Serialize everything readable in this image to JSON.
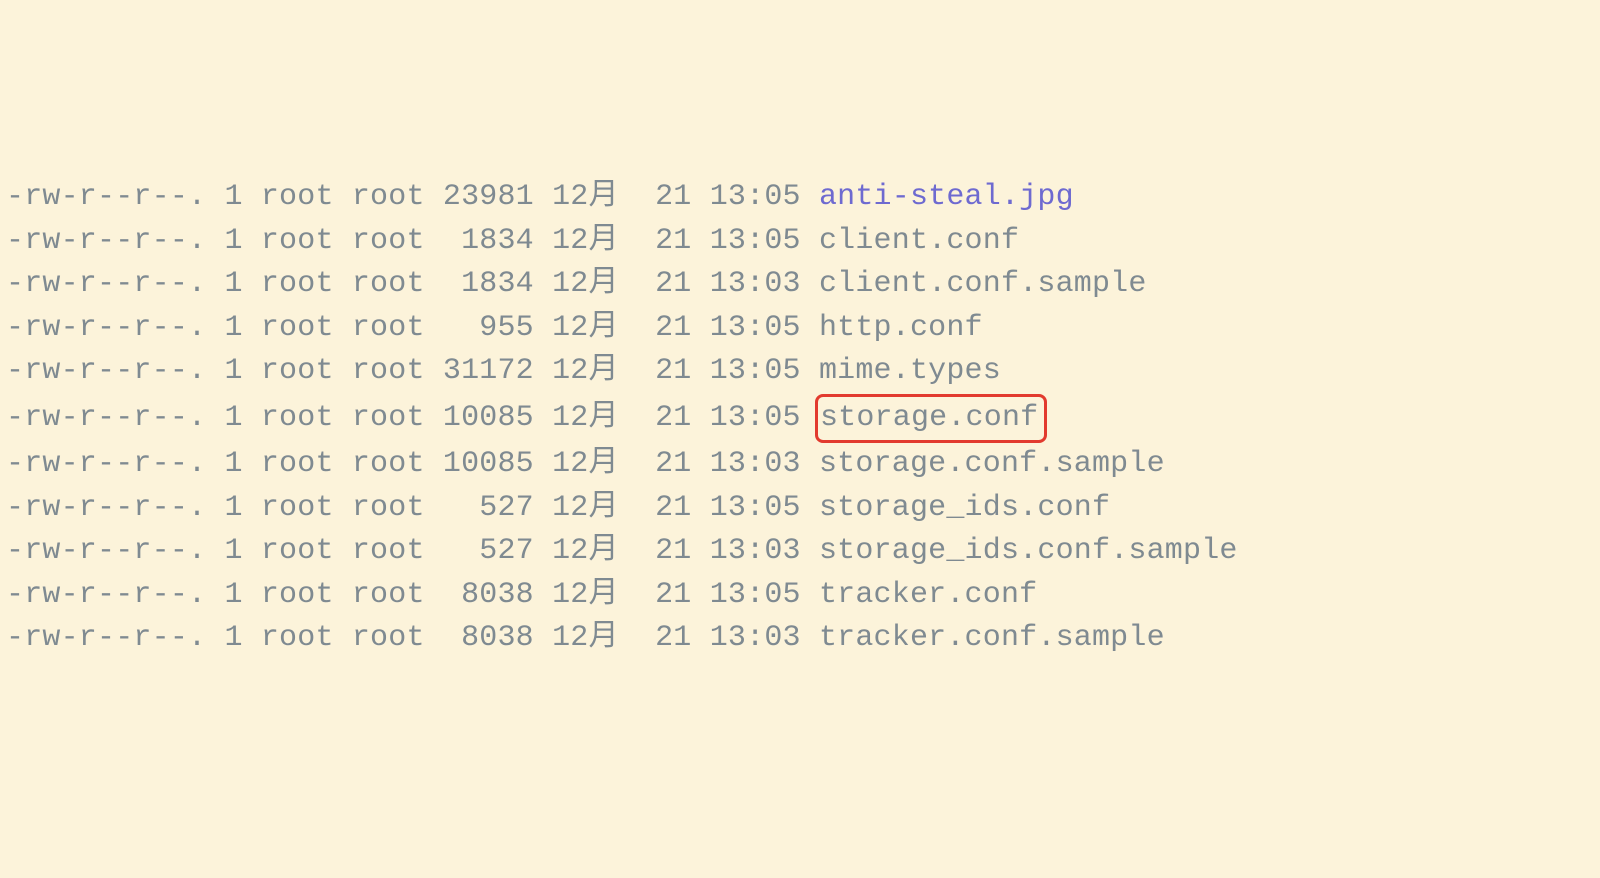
{
  "listing": [
    {
      "perms": "-rw-r--r--.",
      "links": "1",
      "owner": "root",
      "group": "root",
      "size": "23981",
      "month": "12月",
      "day": "21",
      "time": "13:05",
      "name": "anti-steal.jpg",
      "kind": "img",
      "highlighted": false
    },
    {
      "perms": "-rw-r--r--.",
      "links": "1",
      "owner": "root",
      "group": "root",
      "size": " 1834",
      "month": "12月",
      "day": "21",
      "time": "13:05",
      "name": "client.conf",
      "kind": "plain",
      "highlighted": false
    },
    {
      "perms": "-rw-r--r--.",
      "links": "1",
      "owner": "root",
      "group": "root",
      "size": " 1834",
      "month": "12月",
      "day": "21",
      "time": "13:03",
      "name": "client.conf.sample",
      "kind": "plain",
      "highlighted": false
    },
    {
      "perms": "-rw-r--r--.",
      "links": "1",
      "owner": "root",
      "group": "root",
      "size": "  955",
      "month": "12月",
      "day": "21",
      "time": "13:05",
      "name": "http.conf",
      "kind": "plain",
      "highlighted": false
    },
    {
      "perms": "-rw-r--r--.",
      "links": "1",
      "owner": "root",
      "group": "root",
      "size": "31172",
      "month": "12月",
      "day": "21",
      "time": "13:05",
      "name": "mime.types",
      "kind": "plain",
      "highlighted": false
    },
    {
      "perms": "-rw-r--r--.",
      "links": "1",
      "owner": "root",
      "group": "root",
      "size": "10085",
      "month": "12月",
      "day": "21",
      "time": "13:05",
      "name": "storage.conf",
      "kind": "plain",
      "highlighted": true
    },
    {
      "perms": "-rw-r--r--.",
      "links": "1",
      "owner": "root",
      "group": "root",
      "size": "10085",
      "month": "12月",
      "day": "21",
      "time": "13:03",
      "name": "storage.conf.sample",
      "kind": "plain",
      "highlighted": false
    },
    {
      "perms": "-rw-r--r--.",
      "links": "1",
      "owner": "root",
      "group": "root",
      "size": "  527",
      "month": "12月",
      "day": "21",
      "time": "13:05",
      "name": "storage_ids.conf",
      "kind": "plain",
      "highlighted": false
    },
    {
      "perms": "-rw-r--r--.",
      "links": "1",
      "owner": "root",
      "group": "root",
      "size": "  527",
      "month": "12月",
      "day": "21",
      "time": "13:03",
      "name": "storage_ids.conf.sample",
      "kind": "plain",
      "highlighted": false
    },
    {
      "perms": "-rw-r--r--.",
      "links": "1",
      "owner": "root",
      "group": "root",
      "size": " 8038",
      "month": "12月",
      "day": "21",
      "time": "13:05",
      "name": "tracker.conf",
      "kind": "plain",
      "highlighted": false
    },
    {
      "perms": "-rw-r--r--.",
      "links": "1",
      "owner": "root",
      "group": "root",
      "size": " 8038",
      "month": "12月",
      "day": "21",
      "time": "13:03",
      "name": "tracker.conf.sample",
      "kind": "plain",
      "highlighted": false
    }
  ]
}
